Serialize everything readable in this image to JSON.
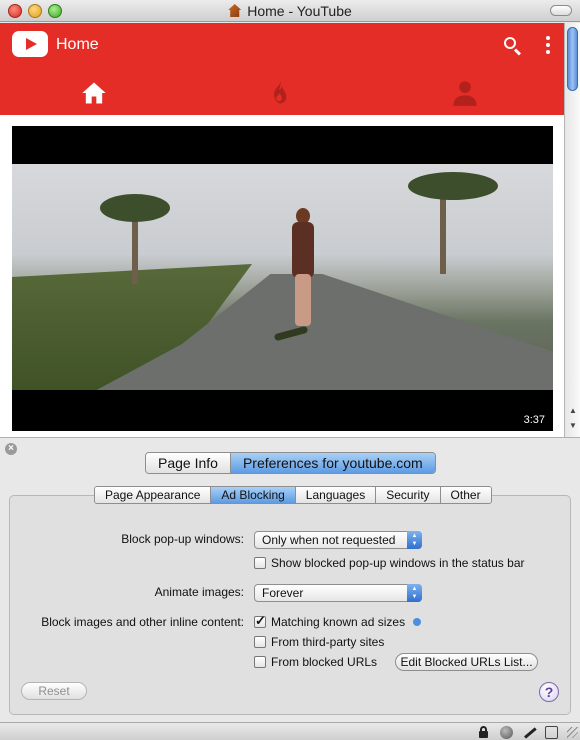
{
  "window": {
    "title": "Home - YouTube"
  },
  "youtube": {
    "header_title": "Home",
    "tabs": [
      "home",
      "trending",
      "account"
    ],
    "video": {
      "duration": "3:37"
    }
  },
  "panel": {
    "top_segments": [
      "Page Info",
      "Preferences for youtube.com"
    ],
    "top_active": "Preferences for youtube.com",
    "inner_segments": [
      "Page Appearance",
      "Ad Blocking",
      "Languages",
      "Security",
      "Other"
    ],
    "inner_active": "Ad Blocking",
    "popups": {
      "label": "Block pop-up windows:",
      "value": "Only when not requested",
      "show_blocked_label": "Show blocked pop-up windows in the status bar",
      "show_blocked_checked": false
    },
    "animate": {
      "label": "Animate images:",
      "value": "Forever"
    },
    "inline": {
      "label": "Block images and other inline content:",
      "options": [
        {
          "label": "Matching known ad sizes",
          "checked": true
        },
        {
          "label": "From third-party sites",
          "checked": false
        },
        {
          "label": "From blocked URLs",
          "checked": false
        }
      ],
      "edit_button": "Edit Blocked URLs List..."
    },
    "reset_button": "Reset",
    "help_button": "?"
  },
  "colors": {
    "youtube_red": "#e52d27",
    "selection_blue": "#5d9be3"
  }
}
